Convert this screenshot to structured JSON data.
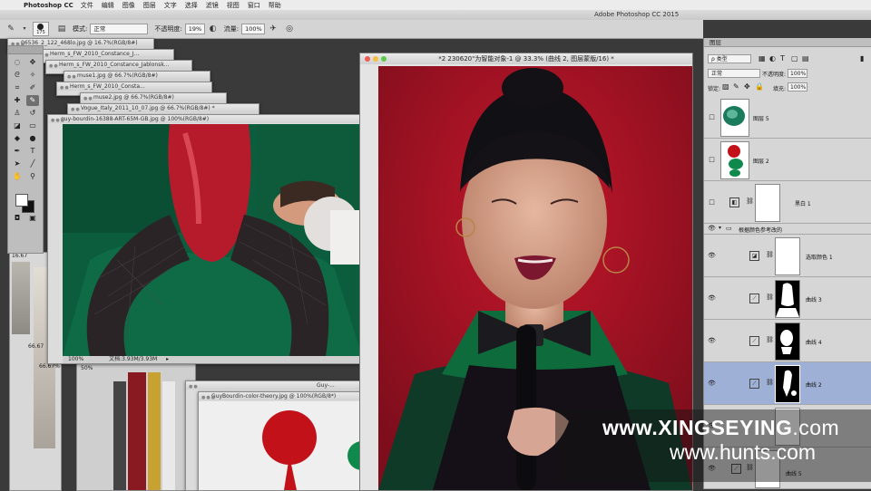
{
  "menubar": {
    "app_name": "Photoshop CC",
    "items": [
      "文件",
      "编辑",
      "图像",
      "图层",
      "文字",
      "选择",
      "滤镜",
      "视图",
      "窗口",
      "帮助"
    ]
  },
  "app_title": "Adobe Photoshop CC 2015",
  "options": {
    "brush_size": "175",
    "mode_label": "模式:",
    "mode_value": "正常",
    "opacity_label": "不透明度:",
    "opacity_value": "19%",
    "flow_label": "流量:",
    "flow_value": "100%"
  },
  "doc_tabs": [
    "06536_2_122_468lo.jpg @ 16.7%(RGB/8#)",
    "Herm_s_FW_2010_Constance_J...",
    "Herm_s_FW_2010_Constance_Jablonsk...",
    "muse1.jpg @ 66.7%(RGB/8#)",
    "Herm_s_FW_2010_Consta...",
    "muse2.jpg @ 66.7%(RGB/8#)",
    "Vogue_Italy_2011_10_07.jpg @ 66.7%(RGB/8#) *",
    "guy-bourdin-16388-ART-65M-GB.jpg @ 100%(RGB/8#)"
  ],
  "guy_doc": {
    "zoom": "100%",
    "status": "文档:3.93M/3.93M"
  },
  "side_zooms": [
    "16.67",
    "66.67",
    "66.67%",
    "50%"
  ],
  "bottom_docs": {
    "tab1": "Guy-...",
    "tab2": "GuyBourdin-color-theory.jpg @ 100%(RGB/8*)"
  },
  "main_doc": {
    "title": "*2 230620\"为智能对象-1 @ 33.3% (曲线 2, 图层蒙版/16) *"
  },
  "layers_panel": {
    "tab": "图层",
    "filter_kind": "ρ 类型",
    "blend_mode": "正常",
    "opacity_label": "不透明度:",
    "opacity_value": "100%",
    "lock_label": "锁定:",
    "fill_label": "填充:",
    "fill_value": "100%",
    "layers": [
      {
        "name": "图层 5"
      },
      {
        "name": "图层 2"
      },
      {
        "name": "黑白 1"
      },
      {
        "name": "根据颜色参考改的"
      },
      {
        "name": "选取颜色 1"
      },
      {
        "name": "曲线 3"
      },
      {
        "name": "曲线 4"
      },
      {
        "name": "曲线 2"
      },
      {
        "name": "曲线 5"
      }
    ]
  },
  "watermark": {
    "line1_main": "www.XINGSEYING",
    "line1_suffix": ".com",
    "line2": "www.hunts.com"
  }
}
